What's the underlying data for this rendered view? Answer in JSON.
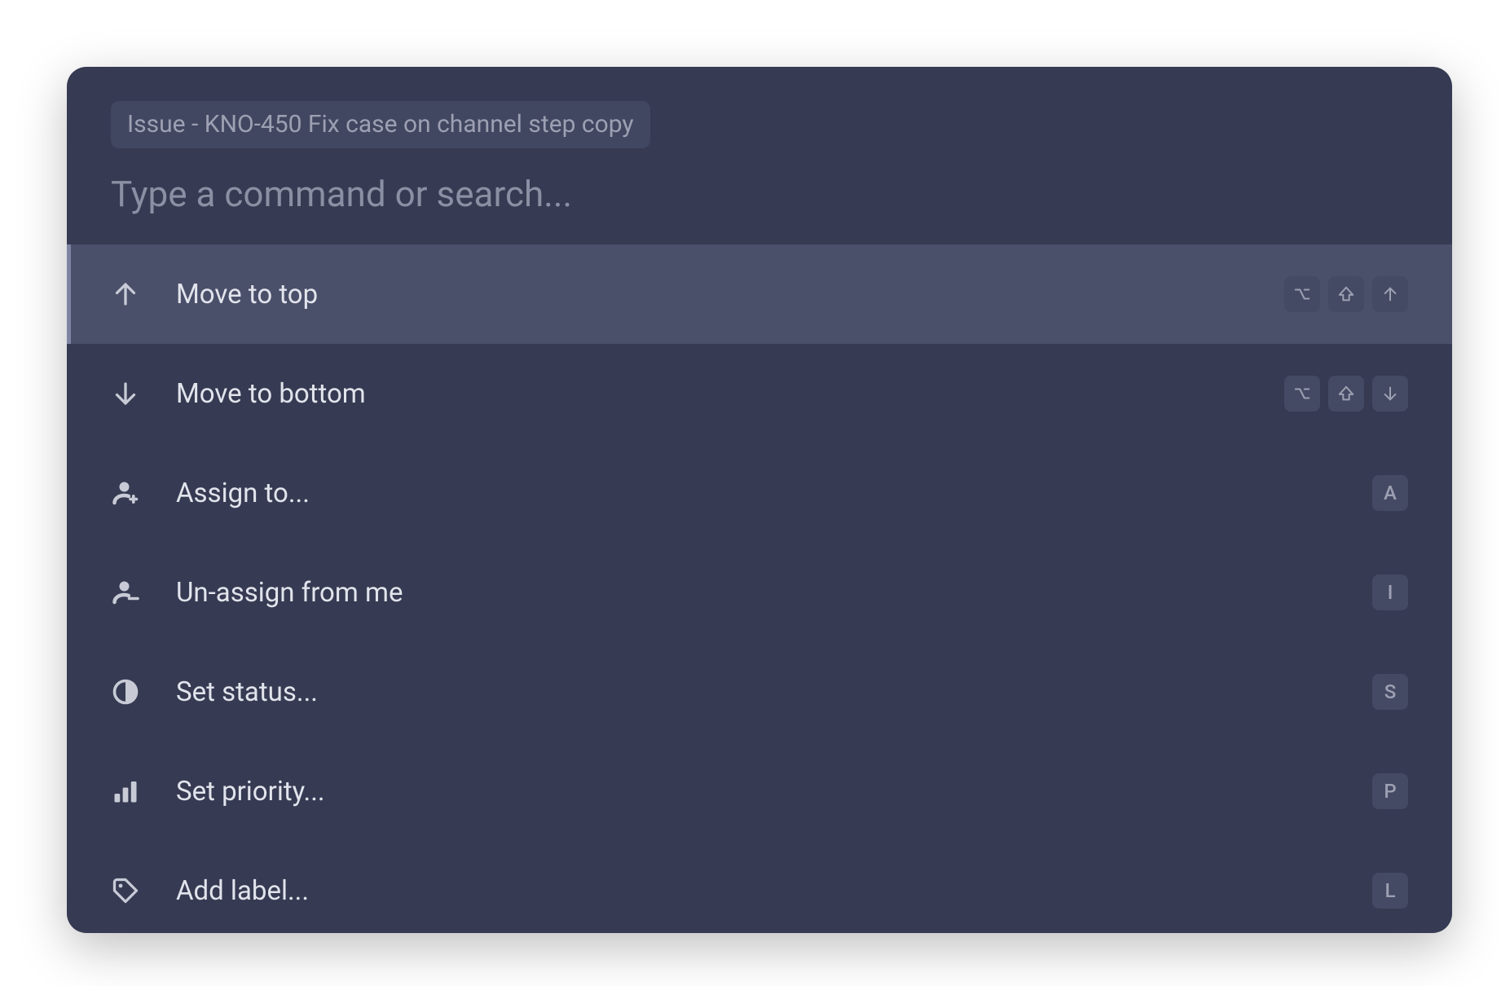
{
  "context": {
    "label": "Issue - KNO-450 Fix case on channel step copy"
  },
  "search": {
    "placeholder": "Type a command or search...",
    "value": ""
  },
  "commands": [
    {
      "id": "move-to-top",
      "icon": "arrow-up-icon",
      "label": "Move to top",
      "selected": true,
      "shortcut": [
        "option",
        "shift",
        "arrow-up"
      ]
    },
    {
      "id": "move-to-bottom",
      "icon": "arrow-down-icon",
      "label": "Move to bottom",
      "selected": false,
      "shortcut": [
        "option",
        "shift",
        "arrow-down"
      ]
    },
    {
      "id": "assign-to",
      "icon": "assign-icon",
      "label": "Assign to...",
      "selected": false,
      "shortcut": [
        "A"
      ]
    },
    {
      "id": "unassign-from-me",
      "icon": "unassign-icon",
      "label": "Un-assign from me",
      "selected": false,
      "shortcut": [
        "I"
      ]
    },
    {
      "id": "set-status",
      "icon": "status-icon",
      "label": "Set status...",
      "selected": false,
      "shortcut": [
        "S"
      ]
    },
    {
      "id": "set-priority",
      "icon": "priority-icon",
      "label": "Set priority...",
      "selected": false,
      "shortcut": [
        "P"
      ]
    },
    {
      "id": "add-label",
      "icon": "label-icon",
      "label": "Add label...",
      "selected": false,
      "shortcut": [
        "L"
      ]
    }
  ]
}
